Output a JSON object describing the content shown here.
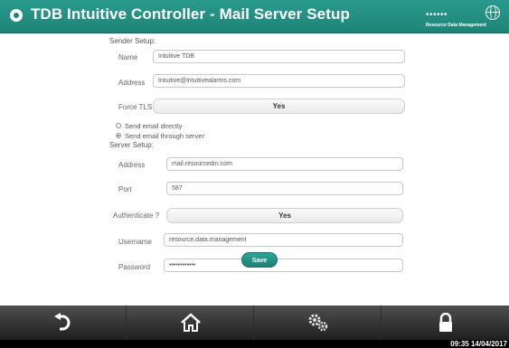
{
  "header": {
    "title": "TDB Intuitive Controller - Mail Server Setup",
    "brand": "Resource Data Management",
    "brand_dots": "••••••"
  },
  "sender": {
    "section_label": "Sender Setup:",
    "name_label": "Name",
    "name_value": "Intuitive TDB",
    "address_label": "Address",
    "address_value": "Intuitive@intuitivealarms.com",
    "force_tls_label": "Force TLS",
    "force_tls_value": "Yes"
  },
  "send_mode": {
    "option_direct": "Send email directly",
    "option_server": "Send email through server",
    "selected": "Send email through server"
  },
  "server": {
    "section_label": "Server Setup:",
    "address_label": "Address",
    "address_value": "mail.resourcedm.com",
    "port_label": "Port",
    "port_value": "587",
    "auth_label": "Authenticate ?",
    "auth_value": "Yes",
    "username_label": "Username",
    "username_value": "resource.data.management",
    "password_label": "Password",
    "password_value": "••••••••••••"
  },
  "actions": {
    "save_label": "Save"
  },
  "nav": {
    "items": [
      "back",
      "home",
      "settings",
      "lock"
    ]
  },
  "status": {
    "clock": "09:35 14/04/2017"
  },
  "colors": {
    "accent": "#1f8478",
    "nav_bg": "#2b2b2b"
  }
}
